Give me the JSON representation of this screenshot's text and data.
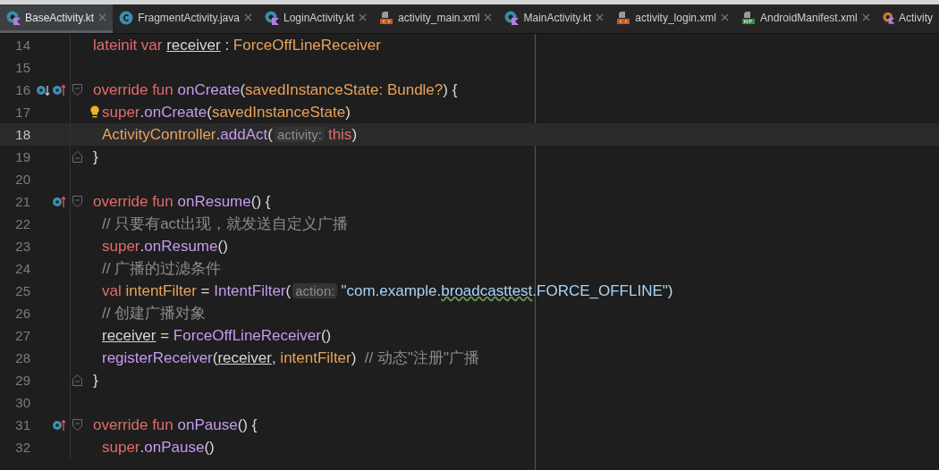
{
  "tabs": [
    {
      "label": "BaseActivity.kt",
      "kind": "kotlin",
      "selected": true
    },
    {
      "label": "FragmentActivity.java",
      "kind": "java",
      "selected": false
    },
    {
      "label": "LoginActivity.kt",
      "kind": "kotlin",
      "selected": false
    },
    {
      "label": "activity_main.xml",
      "kind": "xml",
      "selected": false
    },
    {
      "label": "MainActivity.kt",
      "kind": "kotlin",
      "selected": false
    },
    {
      "label": "activity_login.xml",
      "kind": "xml",
      "selected": false
    },
    {
      "label": "AndroidManifest.xml",
      "kind": "manifest",
      "selected": false
    },
    {
      "label": "Activity",
      "kind": "kotlin-alt",
      "selected": false
    }
  ],
  "lines": [
    {
      "number": "14",
      "current": false,
      "indented": false,
      "tokens": [
        {
          "kind": "keyword",
          "text": "lateinit var "
        },
        {
          "kind": "property",
          "text": "receiver"
        },
        {
          "kind": "plain",
          "text": " : "
        },
        {
          "kind": "type",
          "text": "ForceOffLineReceiver"
        }
      ]
    },
    {
      "number": "15",
      "current": false
    },
    {
      "number": "16",
      "current": false,
      "indented": false,
      "markers": [
        {
          "kind": "override-down"
        },
        {
          "kind": "override-up"
        }
      ],
      "fold": {
        "kind": "start"
      },
      "tokens": [
        {
          "kind": "keyword",
          "text": "override fun "
        },
        {
          "kind": "function",
          "text": "onCreate"
        },
        {
          "kind": "plain",
          "text": "("
        },
        {
          "kind": "type",
          "text": "savedInstanceState: Bundle?"
        },
        {
          "kind": "plain",
          "text": ") {"
        }
      ]
    },
    {
      "number": "17",
      "current": false,
      "indented": true,
      "markers": [
        {
          "kind": "bulb"
        }
      ],
      "tokens": [
        {
          "kind": "keyword",
          "text": "super"
        },
        {
          "kind": "plain",
          "text": "."
        },
        {
          "kind": "function",
          "text": "onCreate"
        },
        {
          "kind": "plain",
          "text": "("
        },
        {
          "kind": "type",
          "text": "savedInstanceState"
        },
        {
          "kind": "plain",
          "text": ")"
        }
      ]
    },
    {
      "number": "18",
      "current": true,
      "indented": true,
      "tokens": [
        {
          "kind": "type",
          "text": "ActivityController"
        },
        {
          "kind": "plain",
          "text": "."
        },
        {
          "kind": "function",
          "text": "addAct"
        },
        {
          "kind": "plain",
          "text": "("
        },
        {
          "kind": "hint",
          "text": "activity:"
        },
        {
          "kind": "keyword",
          "text": "this"
        },
        {
          "kind": "plain",
          "text": ")"
        }
      ]
    },
    {
      "number": "19",
      "current": false,
      "indented": false,
      "fold": {
        "kind": "end"
      },
      "tokens": [
        {
          "kind": "plain",
          "text": "}"
        }
      ]
    },
    {
      "number": "20",
      "current": false
    },
    {
      "number": "21",
      "current": false,
      "indented": false,
      "markers": [
        {
          "kind": "override-up"
        }
      ],
      "fold": {
        "kind": "start"
      },
      "tokens": [
        {
          "kind": "keyword",
          "text": "override fun "
        },
        {
          "kind": "function",
          "text": "onResume"
        },
        {
          "kind": "plain",
          "text": "() {"
        }
      ]
    },
    {
      "number": "22",
      "current": false,
      "indented": true,
      "tokens": [
        {
          "kind": "comment",
          "text": "// 只要有act出现，就发送自定义广播"
        }
      ]
    },
    {
      "number": "23",
      "current": false,
      "indented": true,
      "tokens": [
        {
          "kind": "keyword",
          "text": "super"
        },
        {
          "kind": "plain",
          "text": "."
        },
        {
          "kind": "function",
          "text": "onResume"
        },
        {
          "kind": "plain",
          "text": "()"
        }
      ]
    },
    {
      "number": "24",
      "current": false,
      "indented": true,
      "tokens": [
        {
          "kind": "comment",
          "text": "// 广播的过滤条件"
        }
      ]
    },
    {
      "number": "25",
      "current": false,
      "indented": true,
      "tokens": [
        {
          "kind": "keyword",
          "text": "val "
        },
        {
          "kind": "type",
          "text": "intentFilter"
        },
        {
          "kind": "plain",
          "text": " = "
        },
        {
          "kind": "function",
          "text": "IntentFilter"
        },
        {
          "kind": "plain",
          "text": "("
        },
        {
          "kind": "hint",
          "text": "action:"
        },
        {
          "kind": "string",
          "text": "\"com.example."
        },
        {
          "kind": "typo",
          "text": "broadcasttest"
        },
        {
          "kind": "string",
          "text": ".FORCE_OFFLINE\""
        },
        {
          "kind": "plain",
          "text": ")"
        }
      ]
    },
    {
      "number": "26",
      "current": false,
      "indented": true,
      "tokens": [
        {
          "kind": "comment",
          "text": "// 创建广播对象"
        }
      ]
    },
    {
      "number": "27",
      "current": false,
      "indented": true,
      "tokens": [
        {
          "kind": "property",
          "text": "receiver"
        },
        {
          "kind": "plain",
          "text": " = "
        },
        {
          "kind": "function",
          "text": "ForceOffLineReceiver"
        },
        {
          "kind": "plain",
          "text": "()"
        }
      ]
    },
    {
      "number": "28",
      "current": false,
      "indented": true,
      "tokens": [
        {
          "kind": "function",
          "text": "registerReceiver"
        },
        {
          "kind": "plain",
          "text": "("
        },
        {
          "kind": "property",
          "text": "receiver"
        },
        {
          "kind": "plain",
          "text": ", "
        },
        {
          "kind": "type",
          "text": "intentFilter"
        },
        {
          "kind": "plain",
          "text": ")  "
        },
        {
          "kind": "comment",
          "text": "// 动态\"注册\"广播"
        }
      ]
    },
    {
      "number": "29",
      "current": false,
      "indented": false,
      "fold": {
        "kind": "end"
      },
      "tokens": [
        {
          "kind": "plain",
          "text": "}"
        }
      ]
    },
    {
      "number": "30",
      "current": false
    },
    {
      "number": "31",
      "current": false,
      "indented": false,
      "markers": [
        {
          "kind": "override-up"
        }
      ],
      "fold": {
        "kind": "start"
      },
      "tokens": [
        {
          "kind": "keyword",
          "text": "override fun "
        },
        {
          "kind": "function",
          "text": "onPause"
        },
        {
          "kind": "plain",
          "text": "() {"
        }
      ]
    },
    {
      "number": "32",
      "current": false,
      "indented": true,
      "tokens": [
        {
          "kind": "keyword",
          "text": "super"
        },
        {
          "kind": "plain",
          "text": "."
        },
        {
          "kind": "function",
          "text": "onPause"
        },
        {
          "kind": "plain",
          "text": "()"
        }
      ]
    }
  ]
}
